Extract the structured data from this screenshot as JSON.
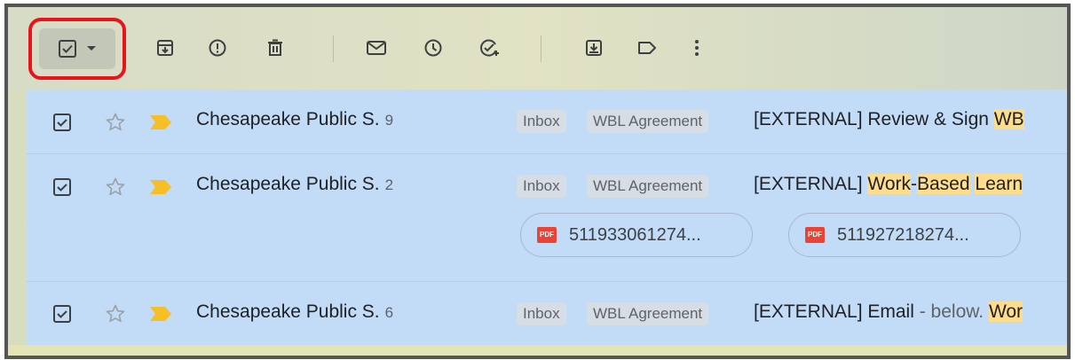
{
  "toolbar": {
    "buttons": [
      {
        "name": "archive",
        "icon": "archive-icon"
      },
      {
        "name": "report-spam",
        "icon": "report-icon"
      },
      {
        "name": "delete",
        "icon": "trash-icon"
      },
      {
        "name": "mark-unread",
        "icon": "envelope-icon"
      },
      {
        "name": "snooze",
        "icon": "clock-icon"
      },
      {
        "name": "add-task",
        "icon": "add-task-icon"
      },
      {
        "name": "move-to",
        "icon": "move-to-icon"
      },
      {
        "name": "labels",
        "icon": "label-icon"
      },
      {
        "name": "more",
        "icon": "more-vert-icon"
      }
    ],
    "select_all_checked": true
  },
  "emails": [
    {
      "sender": "Chesapeake Public S.",
      "count": "9",
      "labels": [
        "Inbox",
        "WBL Agreement"
      ],
      "subject_parts": [
        {
          "text": "[EXTERNAL] Review & Sign ",
          "hl": false
        },
        {
          "text": "WB",
          "hl": true
        }
      ]
    },
    {
      "sender": "Chesapeake Public S.",
      "count": "2",
      "labels": [
        "Inbox",
        "WBL Agreement"
      ],
      "subject_parts": [
        {
          "text": "[EXTERNAL] ",
          "hl": false
        },
        {
          "text": "Work",
          "hl": true
        },
        {
          "text": "-",
          "hl": false
        },
        {
          "text": "Based",
          "hl": true
        },
        {
          "text": " ",
          "hl": false
        },
        {
          "text": "Learn",
          "hl": true
        }
      ],
      "attachments": [
        "511933061274...",
        "511927218274..."
      ]
    },
    {
      "sender": "Chesapeake Public S.",
      "count": "6",
      "labels": [
        "Inbox",
        "WBL Agreement"
      ],
      "subject_parts": [
        {
          "text": "[EXTERNAL] Email",
          "hl": false
        },
        {
          "text": " - below. ",
          "hl": false,
          "snippet": true
        },
        {
          "text": "Wor",
          "hl": true
        }
      ]
    }
  ],
  "colors": {
    "selection_highlight": "#e8141b",
    "row_selected_bg": "#c2dbf6",
    "search_highlight": "#fddc8c",
    "important_marker": "#f6bf26"
  }
}
